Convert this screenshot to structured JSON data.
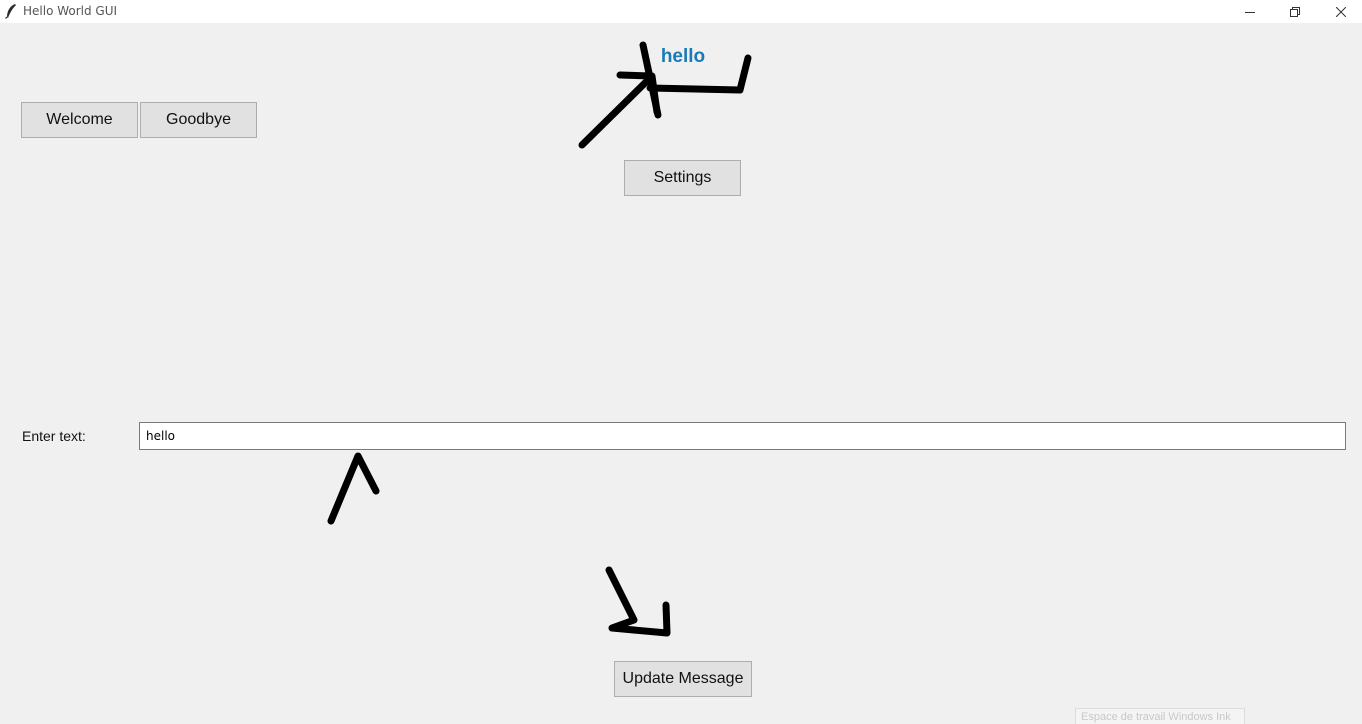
{
  "window": {
    "title": "Hello World GUI",
    "controls": {
      "minimize": "minimize-icon",
      "restore": "restore-icon",
      "close": "close-icon"
    }
  },
  "buttons": {
    "welcome": "Welcome",
    "goodbye": "Goodbye",
    "settings": "Settings",
    "update": "Update Message"
  },
  "message": {
    "text": "hello",
    "color": "#1a7ab8"
  },
  "entry": {
    "label": "Enter text:",
    "value": "hello"
  },
  "annotations": {
    "ink_color": "#000000"
  },
  "taskbar_hint": "Espace de travail Windows Ink"
}
